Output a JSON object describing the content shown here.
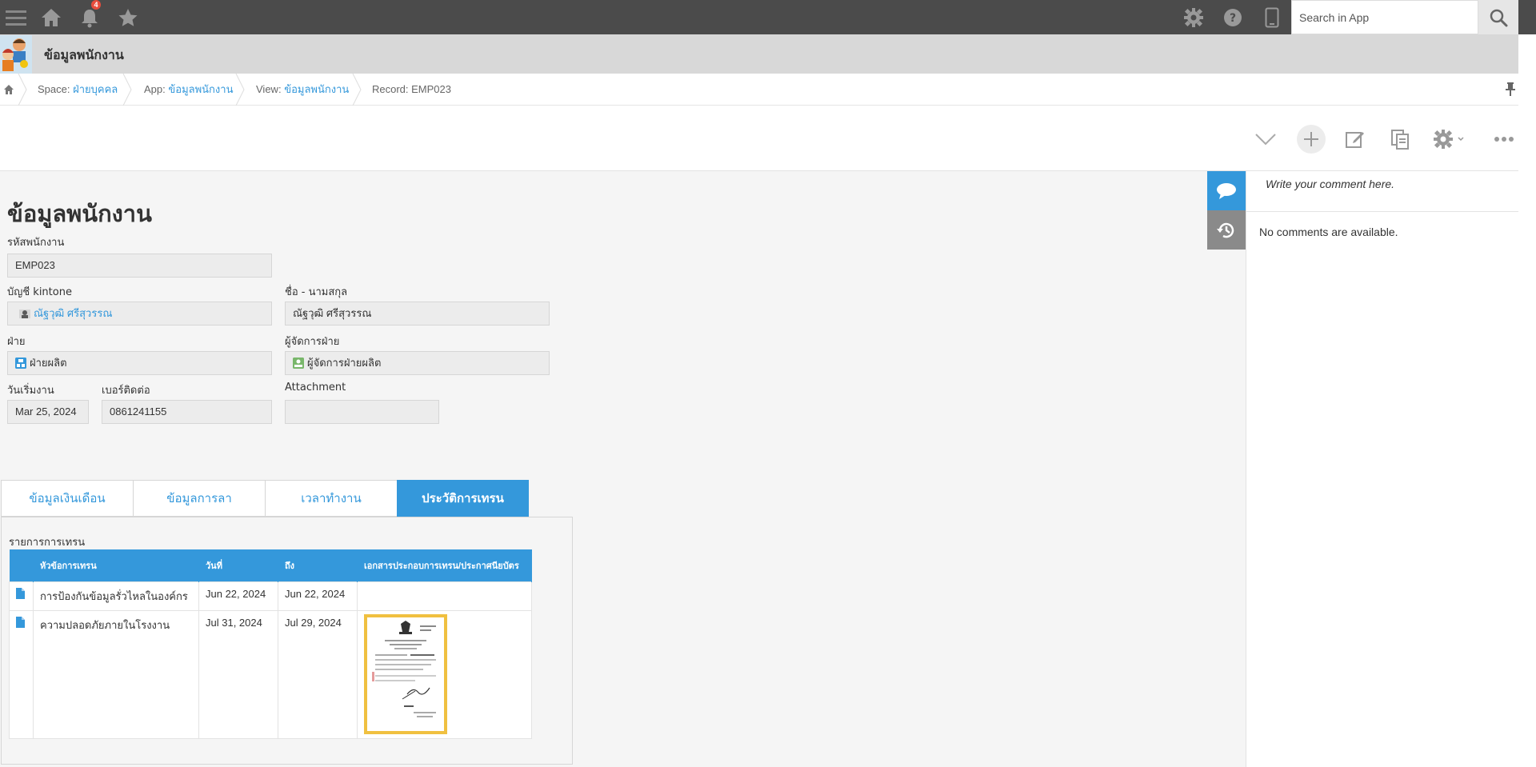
{
  "topbar": {
    "notification_count": "4",
    "search_placeholder": "Search in App",
    "icons": [
      "menu-icon",
      "home-icon",
      "bell-icon",
      "star-icon",
      "gear-icon",
      "help-icon",
      "mobile-icon",
      "search-icon"
    ]
  },
  "app": {
    "title": "ข้อมูลพนักงาน"
  },
  "breadcrumb": {
    "space_label": "Space:",
    "space_value": "ฝ่ายบุคคล",
    "app_label": "App:",
    "app_value": "ข้อมูลพนักงาน",
    "view_label": "View:",
    "view_value": "ข้อมูลพนักงาน",
    "record_text": "Record: EMP023"
  },
  "record": {
    "title": "ข้อมูลพนักงาน",
    "fields": {
      "employee_id": {
        "label": "รหัสพนักงาน",
        "value": "EMP023"
      },
      "kintone_account": {
        "label": "บัญชี kintone",
        "value": "ณัฐวุฒิ ศรีสุวรรณ"
      },
      "full_name": {
        "label": "ชื่อ - นามสกุล",
        "value": "ณัฐวุฒิ ศรีสุวรรณ"
      },
      "department": {
        "label": "ฝ่าย",
        "value": "ฝ่ายผลิต"
      },
      "dept_manager": {
        "label": "ผู้จัดการฝ่าย",
        "value": "ผู้จัดการฝ่ายผลิต"
      },
      "start_date": {
        "label": "วันเริ่มงาน",
        "value": "Mar 25, 2024"
      },
      "phone": {
        "label": "เบอร์ติดต่อ",
        "value": "0861241155"
      },
      "attachment": {
        "label": "Attachment",
        "value": ""
      }
    }
  },
  "tabs": [
    {
      "label": "ข้อมูลเงินเดือน",
      "active": false
    },
    {
      "label": "ข้อมูลการลา",
      "active": false
    },
    {
      "label": "เวลาทำงาน",
      "active": false
    },
    {
      "label": "ประวัติการเทรน",
      "active": true
    }
  ],
  "training": {
    "table_label": "รายการการเทรน",
    "columns": [
      "หัวข้อการเทรน",
      "วันที่",
      "ถึง",
      "เอกสารประกอบการเทรน/ประกาศนียบัตร"
    ],
    "rows": [
      {
        "topic": "การป้องกันข้อมูลรั่วไหลในองค์กร",
        "date": "Jun 22, 2024",
        "to": "Jun 22, 2024",
        "has_doc": false
      },
      {
        "topic": "ความปลอดภัยภายในโรงงาน",
        "date": "Jul 31, 2024",
        "to": "Jul 29, 2024",
        "has_doc": true
      }
    ]
  },
  "comments": {
    "placeholder": "Write your comment here.",
    "empty_text": "No comments are available."
  },
  "colors": {
    "accent": "#3498db",
    "topbar": "#4b4b4b",
    "appbar": "#d8d8d8",
    "badge": "#e74c3c"
  }
}
